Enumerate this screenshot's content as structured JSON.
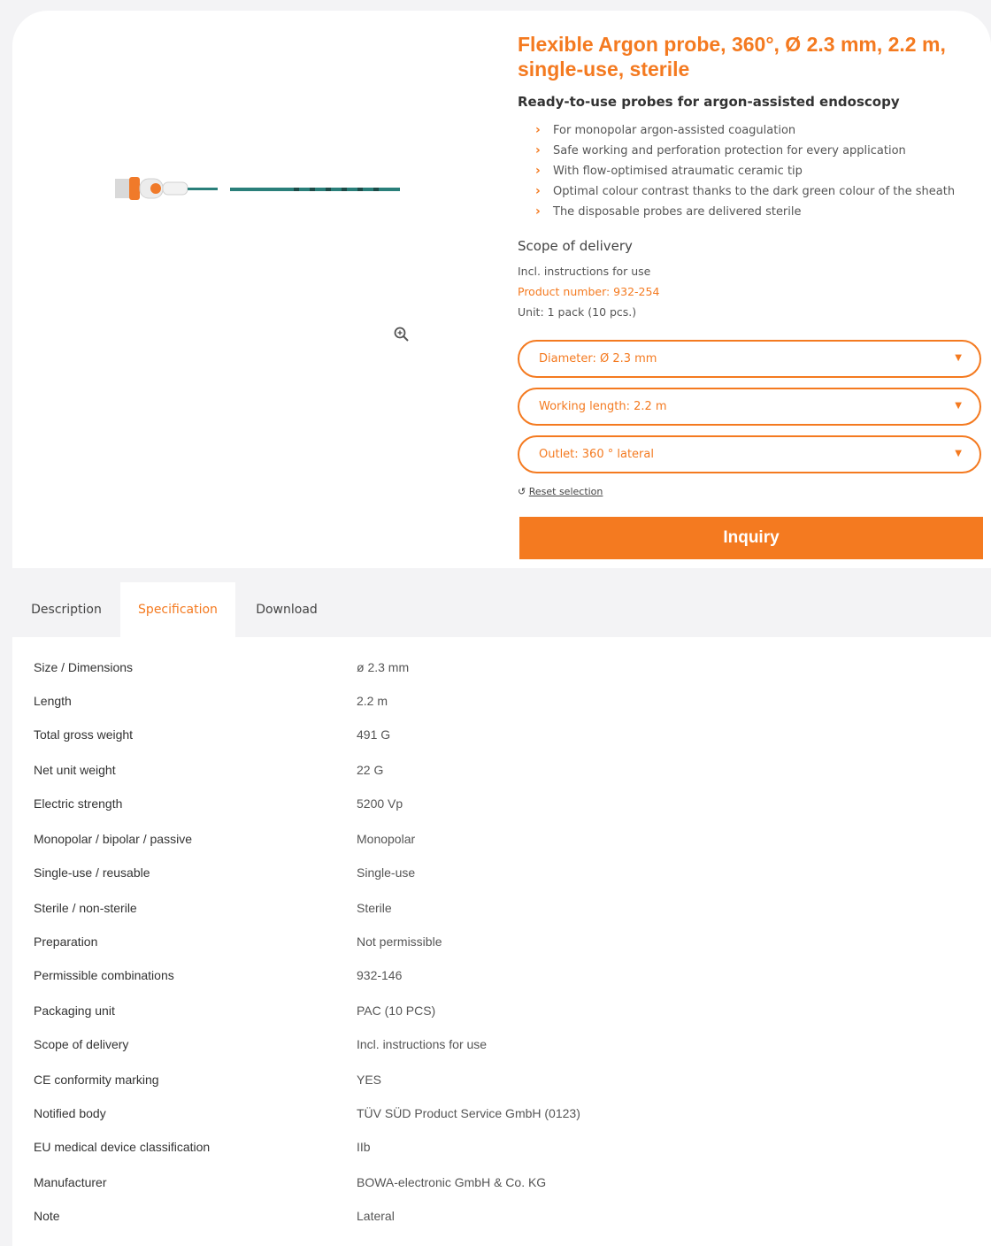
{
  "product": {
    "title": "Flexible Argon probe, 360°, Ø 2.3 mm, 2.2 m, single-use, sterile",
    "subtitle": "Ready-to-use probes for argon-assisted endoscopy",
    "bullets": [
      "For monopolar argon-assisted coagulation",
      "Safe working and perforation protection for every application",
      "With flow-optimised atraumatic ceramic tip",
      "Optimal colour contrast thanks to the dark green colour of the sheath",
      "The disposable probes are delivered sterile"
    ],
    "scope_title": "Scope of delivery",
    "scope_text": "Incl. instructions for use",
    "product_number": "Product number: 932-254",
    "unit": "Unit: 1 pack (10 pcs.)"
  },
  "selects": {
    "diameter": "Diameter: Ø 2.3 mm",
    "length": "Working length: 2.2 m",
    "outlet": "Outlet: 360 ° lateral"
  },
  "reset_label": "Reset selection",
  "inquiry_label": "Inquiry",
  "tabs": [
    "Description",
    "Specification",
    "Download"
  ],
  "specs": [
    {
      "key": "Size / Dimensions",
      "value": "ø 2.3 mm"
    },
    {
      "key": "Length",
      "value": "2.2 m"
    },
    {
      "key": "Total gross weight",
      "value": "491 G"
    },
    {
      "key": "Net unit weight",
      "value": "22 G"
    },
    {
      "key": "Electric strength",
      "value": "5200 Vp"
    },
    {
      "key": "Monopolar / bipolar / passive",
      "value": "Monopolar"
    },
    {
      "key": "Single-use / reusable",
      "value": "Single-use"
    },
    {
      "key": "Sterile / non-sterile",
      "value": "Sterile"
    },
    {
      "key": "Preparation",
      "value": "Not permissible"
    },
    {
      "key": "Permissible combinations",
      "value": "932-146"
    },
    {
      "key": "Packaging unit",
      "value": "PAC (10 PCS)"
    },
    {
      "key": "Scope of delivery",
      "value": "Incl. instructions for use"
    },
    {
      "key": "CE conformity marking",
      "value": "YES"
    },
    {
      "key": "Notified body",
      "value": "TÜV SÜD Product Service GmbH (0123)"
    },
    {
      "key": "EU medical device classification",
      "value": "IIb"
    },
    {
      "key": "Manufacturer",
      "value": "BOWA-electronic GmbH & Co. KG"
    },
    {
      "key": "Note",
      "value": "Lateral"
    }
  ],
  "colors": {
    "accent": "#f47a20",
    "probe_sheath": "#2a7f7a"
  },
  "icons": [
    "zoom-icon",
    "chevron-right-icon",
    "caret-down-icon",
    "reset-icon"
  ]
}
